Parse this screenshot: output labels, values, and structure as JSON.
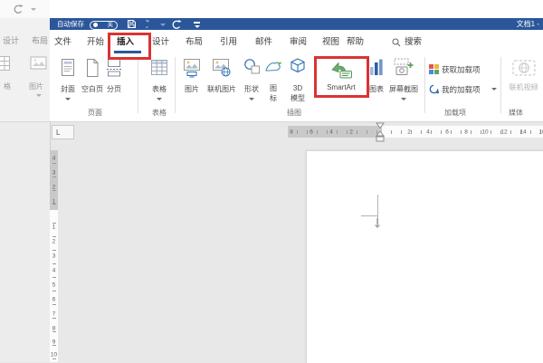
{
  "titlebar": {
    "autosave_label": "自动保存",
    "autosave_state": "关",
    "title": "文档1 -"
  },
  "tabs": {
    "file": "文件",
    "home": "开始",
    "insert": "插入",
    "design": "设计",
    "layout": "布局",
    "references": "引用",
    "mailings": "邮件",
    "review": "审阅",
    "view": "视图",
    "help": "帮助",
    "search": "搜索"
  },
  "background_window": {
    "tab_design": "设计",
    "tab_layout": "布局",
    "label_partial": "格",
    "label_picture": "图片"
  },
  "ribbon": {
    "groups": {
      "pages": "页面",
      "tables": "表格",
      "illustrations": "插图",
      "addins": "加载项",
      "media": "媒体"
    },
    "buttons": {
      "cover_page": "封面",
      "blank_page": "空白页",
      "page_break": "分页",
      "table": "表格",
      "pictures": "图片",
      "online_pictures": "联机图片",
      "shapes": "形状",
      "icons_line1": "图",
      "icons_line2": "标",
      "model_line1": "3D",
      "model_line2": "模型",
      "smartart": "SmartArt",
      "chart": "图表",
      "screenshot": "屏幕截图",
      "get_addins": "获取加载项",
      "my_addins": "我的加载项",
      "online_video": "联机视频"
    }
  },
  "ruler": {
    "tab_selector": "L",
    "h_margin_numbers": [
      "8",
      "6",
      "4",
      "2"
    ],
    "h_numbers": [
      "2",
      "4",
      "6",
      "8",
      "10",
      "12",
      "14",
      "16"
    ],
    "v_margin_numbers": [
      "4",
      "3",
      "2",
      "1"
    ],
    "v_numbers": [
      "1",
      "2",
      "3",
      "4",
      "5",
      "6",
      "7",
      "8",
      "9",
      "10"
    ]
  },
  "annotations": {
    "highlight_color": "#dc3232"
  }
}
